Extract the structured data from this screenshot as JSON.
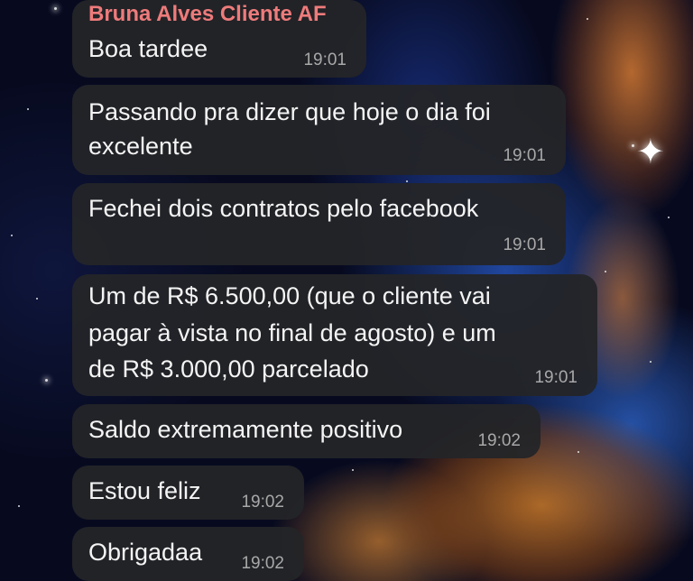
{
  "chat": {
    "sender_name": "Bruna Alves Cliente AF",
    "accent_color": "#ee7b7b",
    "messages": [
      {
        "lines": [
          "Boa tardee"
        ],
        "time": "19:01"
      },
      {
        "lines": [
          "Passando pra dizer que hoje o dia foi",
          "excelente"
        ],
        "time": "19:01"
      },
      {
        "lines": [
          "Fechei dois contratos pelo facebook"
        ],
        "time": "19:01"
      },
      {
        "lines": [
          "Um de R$ 6.500,00 (que o cliente vai",
          "pagar à vista no final de agosto) e um",
          "de R$ 3.000,00 parcelado"
        ],
        "time": "19:01"
      },
      {
        "lines": [
          "Saldo extremamente positivo"
        ],
        "time": "19:02"
      },
      {
        "lines": [
          "Estou feliz"
        ],
        "time": "19:02"
      },
      {
        "lines": [
          "Obrigadaa"
        ],
        "time": "19:02"
      }
    ]
  }
}
